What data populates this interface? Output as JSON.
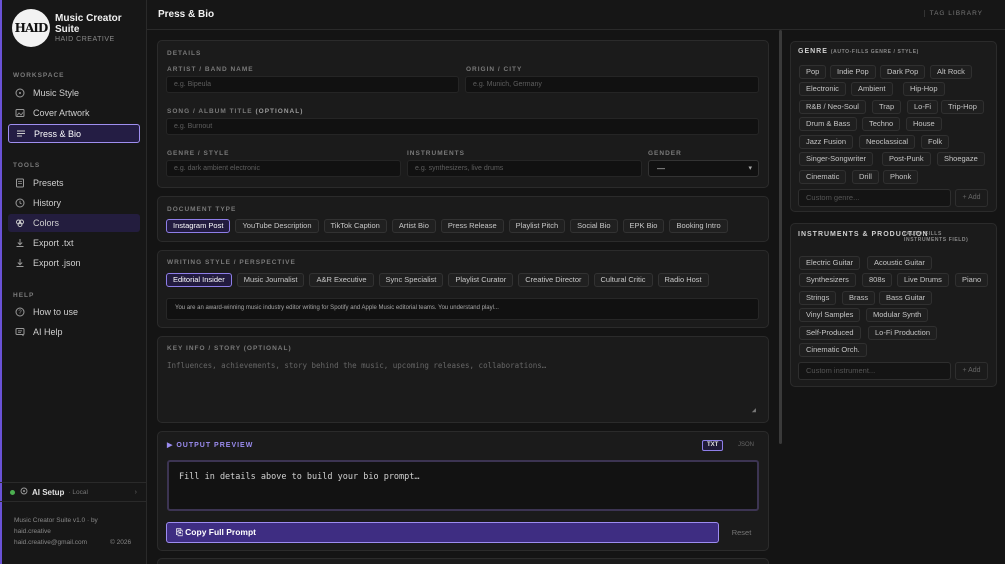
{
  "brand": {
    "logo_text": "HAID",
    "title": "Music Creator Suite",
    "subtitle": "HAID CREATIVE"
  },
  "sidebar": {
    "workspace_label": "WORKSPACE",
    "workspace": [
      {
        "label": "Music Style",
        "icon": "music-circle-icon"
      },
      {
        "label": "Cover Artwork",
        "icon": "image-icon"
      },
      {
        "label": "Press & Bio",
        "icon": "text-lines-icon"
      }
    ],
    "tools_label": "TOOLS",
    "tools": [
      {
        "label": "Presets",
        "icon": "preset-icon"
      },
      {
        "label": "History",
        "icon": "clock-icon"
      },
      {
        "label": "Colors",
        "icon": "palette-icon"
      },
      {
        "label": "Export .txt",
        "icon": "download-icon"
      },
      {
        "label": "Export .json",
        "icon": "download-icon"
      }
    ],
    "help_label": "HELP",
    "help": [
      {
        "label": "How to use",
        "icon": "help-circle-icon"
      },
      {
        "label": "AI Help",
        "icon": "ai-help-icon"
      }
    ],
    "ai_setup": {
      "label": "AI Setup",
      "mode": "· Local",
      "chevron": "›"
    },
    "footer": {
      "line1": "Music Creator Suite v1.0 · by",
      "line2": "haid.creative",
      "email": "haid.creative@gmail.com",
      "year": "© 2026"
    }
  },
  "header": {
    "title": "Press & Bio",
    "tag_library": "TAG LIBRARY"
  },
  "details": {
    "section": "DETAILS",
    "artist_label": "ARTIST / BAND NAME",
    "artist_placeholder": "e.g. Bipeula",
    "origin_label": "ORIGIN / CITY",
    "origin_placeholder": "e.g. Munich, Germany",
    "song_label": "SONG / ALBUM TITLE",
    "song_optional": "(OPTIONAL)",
    "song_placeholder": "e.g. Burnout",
    "genre_label": "GENRE / STYLE",
    "genre_placeholder": "e.g. dark ambient electronic",
    "instruments_label": "INSTRUMENTS",
    "instruments_placeholder": "e.g. synthesizers, live drums",
    "gender_label": "GENDER",
    "gender_value": "—"
  },
  "document_type": {
    "section": "DOCUMENT TYPE",
    "options": [
      "Instagram Post",
      "YouTube Description",
      "TikTok Caption",
      "Artist Bio",
      "Press Release",
      "Playlist Pitch",
      "Social Bio",
      "EPK Bio",
      "Booking Intro"
    ],
    "selected": "Instagram Post"
  },
  "writing_style": {
    "section": "WRITING STYLE / PERSPECTIVE",
    "options": [
      "Editorial Insider",
      "Music Journalist",
      "A&R Executive",
      "Sync Specialist",
      "Playlist Curator",
      "Creative Director",
      "Cultural Critic",
      "Radio Host"
    ],
    "selected": "Editorial Insider",
    "prompt": "You are an award-winning music industry editor writing for Spotify and Apple Music editorial teams. You understand playl..."
  },
  "key_info": {
    "section": "KEY INFO / STORY (OPTIONAL)",
    "placeholder": "Influences, achievements, story behind the music, upcoming releases, collaborations…"
  },
  "output": {
    "section": "▶ OUTPUT PREVIEW",
    "formats": [
      "TXT",
      "JSON"
    ],
    "preview_text": "Fill in details above to build your bio prompt…",
    "copy_label": "Copy Full Prompt",
    "reset_label": "Reset"
  },
  "genre_panel": {
    "title": "GENRE",
    "auto": "(AUTO-FILLS GENRE / STYLE)",
    "tags": [
      "Pop",
      "Indie Pop",
      "Dark Pop",
      "Alt Rock",
      "Electronic",
      "Ambient",
      "Hip-Hop",
      "R&B / Neo-Soul",
      "Trap",
      "Lo-Fi",
      "Trip-Hop",
      "Drum & Bass",
      "Techno",
      "House",
      "Jazz Fusion",
      "Neoclassical",
      "Folk",
      "Singer-Songwriter",
      "Post-Punk",
      "Shoegaze",
      "Cinematic",
      "Drill",
      "Phonk"
    ],
    "custom_placeholder": "Custom genre...",
    "add_label": "+ Add"
  },
  "instr_panel": {
    "title": "INSTRUMENTS & PRODUCTION",
    "auto": "(AUTO-FILLS INSTRUMENTS FIELD)",
    "tags": [
      "Electric Guitar",
      "Acoustic Guitar",
      "Synthesizers",
      "808s",
      "Live Drums",
      "Piano",
      "Strings",
      "Brass",
      "Bass Guitar",
      "Vinyl Samples",
      "Modular Synth",
      "Self-Produced",
      "Lo-Fi Production",
      "Cinematic Orch."
    ],
    "custom_placeholder": "Custom instrument...",
    "add_label": "+ Add"
  }
}
